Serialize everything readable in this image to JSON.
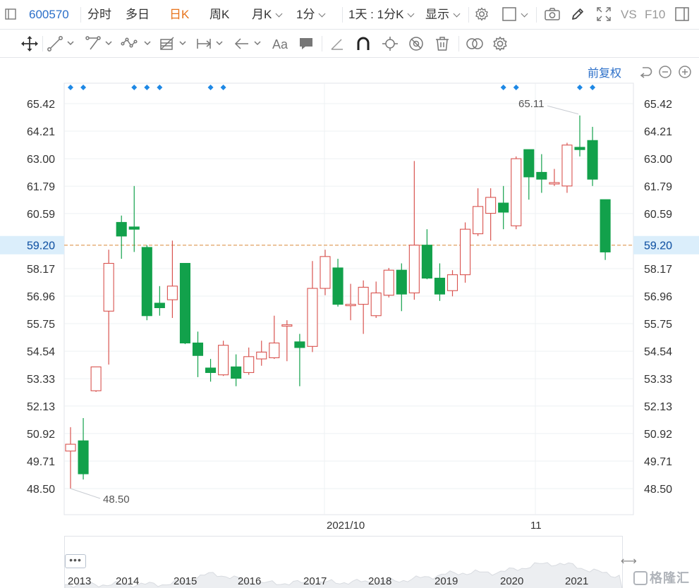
{
  "toolbar": {
    "stock_code": "600570",
    "intraday": "分时",
    "multi_day": "多日",
    "daily_k": "日K",
    "weekly_k": "周K",
    "monthly_k": "月K",
    "minute": "1分",
    "period_range": "1天 : 1分K",
    "display": "显示",
    "vs": "VS",
    "f10": "F10"
  },
  "chart_header": {
    "restore_label": "前复权"
  },
  "colors": {
    "up": "#d9534f",
    "down": "#12a14b",
    "current_line": "#e0a060",
    "current_bg": "#dbeefb",
    "grid": "#eef0f3",
    "accent_blue": "#2b6fc9",
    "marker": "#1e88e5"
  },
  "chart_data": {
    "type": "candlestick",
    "y_ticks": [
      "65.42",
      "64.21",
      "63.00",
      "61.79",
      "60.59",
      "59.20",
      "58.17",
      "56.96",
      "55.75",
      "54.54",
      "53.33",
      "52.13",
      "50.92",
      "49.71",
      "48.50"
    ],
    "y_tick_values": [
      65.42,
      64.21,
      63.0,
      61.79,
      60.59,
      58.17,
      56.96,
      55.75,
      54.54,
      53.33,
      52.13,
      50.92,
      49.71,
      48.5
    ],
    "ylim": [
      48.5,
      65.42
    ],
    "current_price": 59.2,
    "current_price_label": "59.20",
    "high_label": "65.11",
    "low_label": "48.50",
    "x_labels": [
      "2021/10",
      "11"
    ],
    "grid": true,
    "candles": [
      [
        50.15,
        50.45,
        51.2,
        48.5
      ],
      [
        50.6,
        49.15,
        51.6,
        48.9
      ],
      [
        52.8,
        53.85,
        53.85,
        52.75
      ],
      [
        56.3,
        58.4,
        59.0,
        53.95
      ],
      [
        60.2,
        59.6,
        60.5,
        58.6
      ],
      [
        60.0,
        59.9,
        61.8,
        58.9
      ],
      [
        59.1,
        56.1,
        59.2,
        55.9
      ],
      [
        56.65,
        56.45,
        57.4,
        56.1
      ],
      [
        56.8,
        57.4,
        59.4,
        56.0
      ],
      [
        58.4,
        54.9,
        58.4,
        54.85
      ],
      [
        54.9,
        54.35,
        55.4,
        53.4
      ],
      [
        53.8,
        53.6,
        54.2,
        53.2
      ],
      [
        53.5,
        54.8,
        55.0,
        53.45
      ],
      [
        53.85,
        53.35,
        54.4,
        53.0
      ],
      [
        53.6,
        54.3,
        54.7,
        53.5
      ],
      [
        54.2,
        54.5,
        55.0,
        53.9
      ],
      [
        54.25,
        54.9,
        56.1,
        54.2
      ],
      [
        55.7,
        55.7,
        55.9,
        54.1
      ],
      [
        54.95,
        54.7,
        55.3,
        53.0
      ],
      [
        54.75,
        57.3,
        58.5,
        54.5
      ],
      [
        57.3,
        58.7,
        59.0,
        57.0
      ],
      [
        58.2,
        56.6,
        58.6,
        56.5
      ],
      [
        56.6,
        56.6,
        57.5,
        55.9
      ],
      [
        56.6,
        57.35,
        57.65,
        55.3
      ],
      [
        56.1,
        57.1,
        57.6,
        56.0
      ],
      [
        57.0,
        58.1,
        58.2,
        56.9
      ],
      [
        58.1,
        57.05,
        58.4,
        56.3
      ],
      [
        57.1,
        59.2,
        62.9,
        56.8
      ],
      [
        59.2,
        57.75,
        59.9,
        57.7
      ],
      [
        57.75,
        57.05,
        58.4,
        56.75
      ],
      [
        57.2,
        57.9,
        58.1,
        56.95
      ],
      [
        57.9,
        59.9,
        60.2,
        57.55
      ],
      [
        59.7,
        60.9,
        61.7,
        59.6
      ],
      [
        60.6,
        61.3,
        61.7,
        59.4
      ],
      [
        61.05,
        60.65,
        61.8,
        59.9
      ],
      [
        60.05,
        63.0,
        63.1,
        59.9
      ],
      [
        63.4,
        62.2,
        63.4,
        61.2
      ],
      [
        62.4,
        62.1,
        63.2,
        61.5
      ],
      [
        61.95,
        61.95,
        62.55,
        61.8
      ],
      [
        61.8,
        63.6,
        63.7,
        61.5
      ],
      [
        63.5,
        63.4,
        64.9,
        63.1
      ],
      [
        63.8,
        62.1,
        64.4,
        61.8
      ],
      [
        61.2,
        58.9,
        61.2,
        58.55
      ]
    ],
    "marker_groups": [
      [
        0,
        1
      ],
      [
        5,
        6,
        7
      ],
      [
        11,
        12
      ],
      [
        34,
        35
      ],
      [
        40,
        41
      ]
    ]
  },
  "navigator": {
    "years": [
      "2013",
      "2014",
      "2015",
      "2016",
      "2017",
      "2018",
      "2019",
      "2020",
      "2021"
    ],
    "handle_label": "•••",
    "resize_arrow": "⟷",
    "watermark": "格隆汇"
  }
}
